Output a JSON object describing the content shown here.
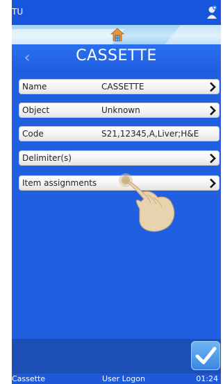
{
  "topbar": {
    "label": "TU",
    "user_icon": "user-icon"
  },
  "nav": {
    "home_icon": "home-icon",
    "back_icon": "chevron-left-icon"
  },
  "page": {
    "title": "CASSETTE"
  },
  "rows": [
    {
      "label": "Name",
      "value": "CASSETTE",
      "arrow": true
    },
    {
      "label": "Object",
      "value": "Unknown",
      "arrow": true
    },
    {
      "label": "Code",
      "value": "S21,12345,A,Liver;H&E",
      "arrow": false
    },
    {
      "label": "Delimiter(s)",
      "value": "",
      "arrow": true
    },
    {
      "label": "Item assignments",
      "value": "",
      "arrow": true
    }
  ],
  "status": {
    "left": "Cassette",
    "middle": "User Logon",
    "time": "01:24"
  },
  "colors": {
    "background": "#1f5fe0",
    "accent": "#9ed2f3"
  }
}
